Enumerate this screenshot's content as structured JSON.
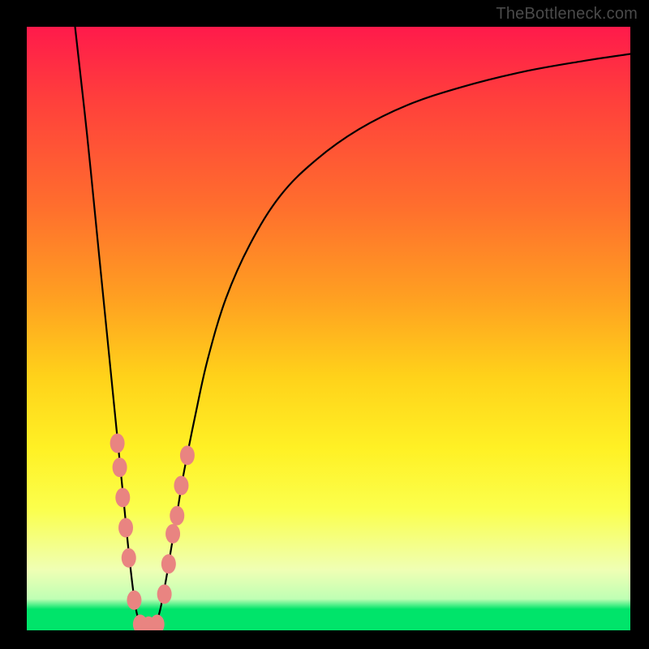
{
  "watermark": {
    "text": "TheBottleneck.com"
  },
  "chart_data": {
    "type": "line",
    "title": "",
    "xlabel": "",
    "ylabel": "",
    "xlim": [
      0,
      100
    ],
    "ylim": [
      0,
      100
    ],
    "gradient_bands": [
      {
        "color": "#ff1a4b",
        "stop": 0
      },
      {
        "color": "#ff3f3c",
        "stop": 12
      },
      {
        "color": "#ff6f2d",
        "stop": 30
      },
      {
        "color": "#ffa021",
        "stop": 45
      },
      {
        "color": "#ffd21a",
        "stop": 58
      },
      {
        "color": "#fff125",
        "stop": 70
      },
      {
        "color": "#fbff4d",
        "stop": 80
      },
      {
        "color": "#efffb4",
        "stop": 90
      },
      {
        "color": "#bfffb4",
        "stop": 94.8
      },
      {
        "color": "#00e46a",
        "stop": 96.5
      },
      {
        "color": "#00e46a",
        "stop": 100
      }
    ],
    "series": [
      {
        "name": "bottleneck-curve",
        "x": [
          8.0,
          10,
          12,
          13,
          14,
          15,
          16,
          17,
          18,
          19,
          20,
          21,
          22,
          23,
          24,
          25,
          26,
          28,
          30,
          33,
          37,
          42,
          48,
          55,
          63,
          72,
          82,
          92,
          100
        ],
        "y": [
          100,
          82,
          62,
          52,
          42,
          32,
          22,
          12,
          4,
          0.5,
          0.5,
          0.5,
          3,
          8,
          14,
          20,
          26,
          36,
          45,
          55,
          64,
          72,
          78,
          83,
          87,
          90,
          92.5,
          94.3,
          95.5
        ]
      }
    ],
    "markers": {
      "name": "highlighted-points",
      "color": "#e98481",
      "points": [
        {
          "x": 15.0,
          "y": 31
        },
        {
          "x": 15.4,
          "y": 27
        },
        {
          "x": 15.9,
          "y": 22
        },
        {
          "x": 16.4,
          "y": 17
        },
        {
          "x": 16.9,
          "y": 12
        },
        {
          "x": 17.8,
          "y": 5
        },
        {
          "x": 18.8,
          "y": 1
        },
        {
          "x": 20.2,
          "y": 0.7
        },
        {
          "x": 21.6,
          "y": 1
        },
        {
          "x": 22.8,
          "y": 6
        },
        {
          "x": 23.5,
          "y": 11
        },
        {
          "x": 24.2,
          "y": 16
        },
        {
          "x": 24.9,
          "y": 19
        },
        {
          "x": 25.6,
          "y": 24
        },
        {
          "x": 26.6,
          "y": 29
        }
      ]
    }
  }
}
